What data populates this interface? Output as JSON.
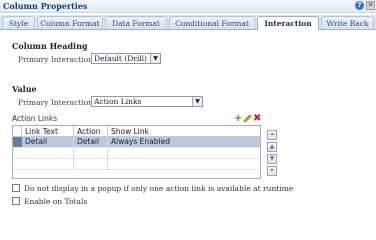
{
  "dialog": {
    "title": "Column Properties"
  },
  "tabs": [
    {
      "label": "Style"
    },
    {
      "label": "Column Format"
    },
    {
      "label": "Data Format"
    },
    {
      "label": "Conditional Format"
    },
    {
      "label": "Interaction"
    },
    {
      "label": "Write Back"
    }
  ],
  "active_tab": "Interaction",
  "column_heading": {
    "title": "Column Heading",
    "primary_interaction_label": "Primary Interaction",
    "primary_interaction_value": "Default (Drill)"
  },
  "value": {
    "title": "Value",
    "primary_interaction_label": "Primary Interaction",
    "primary_interaction_value": "Action Links"
  },
  "action_links": {
    "label": "Action Links",
    "columns": [
      "Link Text",
      "Action",
      "Show Link"
    ],
    "rows": [
      {
        "link_text": "Detail",
        "action": "Detail",
        "show_link": "Always Enabled",
        "selected": true
      }
    ]
  },
  "options": {
    "no_popup_label": "Do not display in a popup if only one action link is available at runtime",
    "no_popup_checked": false,
    "enable_on_totals_label": "Enable on Totals",
    "enable_on_totals_checked": false
  },
  "icons": [
    "help-icon",
    "close-icon",
    "add-icon",
    "edit-icon",
    "delete-icon",
    "move-top-icon",
    "move-up-icon",
    "move-down-icon",
    "move-bottom-icon"
  ],
  "colors": {
    "selected_row": "#b9c9df",
    "title": "#1d3f6e",
    "add_icon": "#2e9a2e",
    "delete_icon": "#c8261d"
  }
}
